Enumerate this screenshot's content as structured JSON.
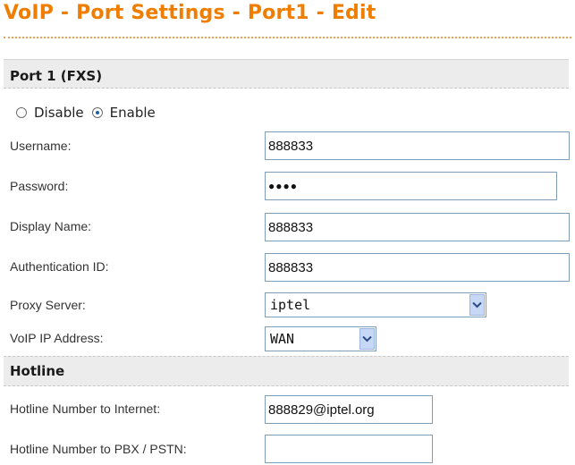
{
  "page_title": "VoIP - Port Settings - Port1 - Edit",
  "sections": {
    "port": "Port 1 (FXS)",
    "hotline": "Hotline"
  },
  "status": {
    "disable_label": "Disable",
    "enable_label": "Enable",
    "selected": "Enable"
  },
  "fields": {
    "username": {
      "label": "Username:",
      "value": "888833"
    },
    "password": {
      "label": "Password:",
      "value": "●●●●"
    },
    "display_name": {
      "label": "Display Name:",
      "value": "888833"
    },
    "auth_id": {
      "label": "Authentication ID:",
      "value": "888833"
    },
    "proxy_server": {
      "label": "Proxy Server:",
      "value": "iptel"
    },
    "voip_ip": {
      "label": "VoIP IP Address:",
      "value": "WAN"
    },
    "hotline_internet": {
      "label": "Hotline Number to Internet:",
      "value": "888829@iptel.org"
    },
    "hotline_pbx": {
      "label": "Hotline Number to PBX / PSTN:",
      "value": ""
    }
  },
  "icons": {
    "dropdown_arrow": "chevron-down-icon"
  }
}
